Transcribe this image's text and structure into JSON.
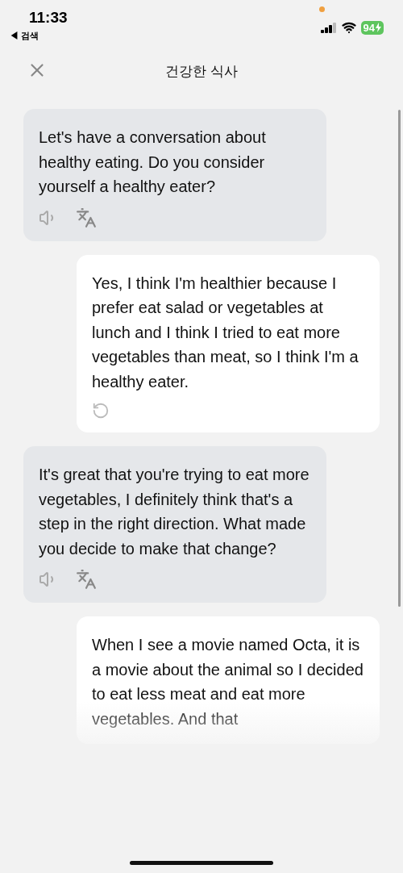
{
  "status_bar": {
    "time": "11:33",
    "back_label": "◀ 검색",
    "battery": "94"
  },
  "header": {
    "title": "건강한 식사"
  },
  "messages": [
    {
      "kind": "bot",
      "text": "Let's have a conversation about healthy eating. Do you consider yourself a healthy eater?"
    },
    {
      "kind": "user",
      "text": "Yes, I think I'm healthier because I prefer eat salad or vegetables at lunch and I think I tried to eat more vegetables than meat, so I think I'm a healthy eater."
    },
    {
      "kind": "bot",
      "text": "It's great that you're trying to eat more vegetables, I definitely think that's a step in the right direction. What made you decide to make that change?"
    },
    {
      "kind": "user_cut",
      "text": "When I see a movie named Octa, it is a movie about the animal so I decided to eat less meat and eat more vegetables. And that"
    }
  ]
}
